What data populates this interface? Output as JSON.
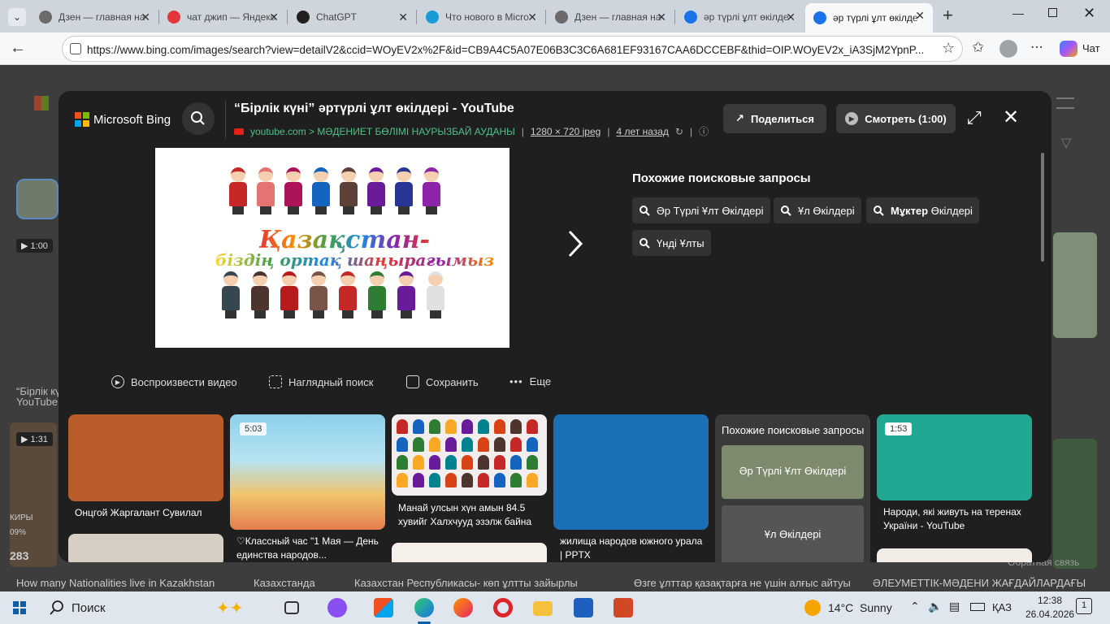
{
  "browser": {
    "tabs": [
      {
        "title": "Дзен — главная на",
        "fav_color": "#6b6b6b"
      },
      {
        "title": "чат джип — Яндекс",
        "fav_color": "#e2383c"
      },
      {
        "title": "ChatGPT",
        "fav_color": "#202020"
      },
      {
        "title": "Что нового в Micro",
        "fav_color": "#1a9bd7"
      },
      {
        "title": "Дзен — главная на",
        "fav_color": "#6b6b6b"
      },
      {
        "title": "әр түрлі ұлт өкілде",
        "fav_color": "#1a73e8"
      },
      {
        "title": "әр түрлі ұлт өкілде",
        "fav_color": "#1a73e8"
      }
    ],
    "url": "https://www.bing.com/images/search?view=detailV2&ccid=WOyEV2x%2F&id=CB9A4C5A07E06B3C3C6A681EF93167CAA6DCCEBF&thid=OIP.WOyEV2x_iA3SjM2YpnP...",
    "copilot_label": "Чат"
  },
  "modal": {
    "brand": "Microsoft Bing",
    "title": "“Бірлік күні” әртүрлі ұлт өкілдері - YouTube",
    "source": "youtube.com > МӘДЕНИЕТ БӨЛІМІ НАУРЫЗБАЙ АУДАНЫ",
    "dimensions": "1280 × 720 jpeg",
    "age": "4 лет назад",
    "share_label": "Поделиться",
    "watch_label": "Смотреть (1:00)",
    "image_text_line1": "Қазақстан-",
    "image_text_line2": "біздің ортақ шаңырағымыз",
    "related_heading": "Похожие поисковые запросы",
    "related_chips": [
      {
        "prefix": "",
        "text": "Әр Түрлі Ұлт Өкілдері"
      },
      {
        "prefix": "",
        "text": "Ұл Өкілдері"
      },
      {
        "prefix": "Мұктер",
        "text": " Өкілдері"
      },
      {
        "prefix": "",
        "text": "Үнді Ұлты"
      }
    ],
    "actions": [
      "Воспроизвести видео",
      "Наглядный поиск",
      "Сохранить",
      "Еще"
    ],
    "cards": [
      {
        "caption": "Онцгой Жаргалант Сувилал",
        "duration": "",
        "color": "#b85c2a"
      },
      {
        "caption": "♡Классный час \"1 Мая — День единства народов...",
        "duration": "5:03",
        "color": "#7bbfd8"
      },
      {
        "caption": "Манай улсын хүн амын 84.5 хувийг Халхчууд эзэлж байна",
        "duration": "",
        "color": "#e8e4e4"
      },
      {
        "caption": "жилища народов южного урала | PPTX",
        "duration": "",
        "color": "#1b6fb4"
      },
      {
        "caption": "Народи, які живуть на теренах України - YouTube",
        "duration": "1:53",
        "color": "#22a892"
      }
    ],
    "related_card": {
      "heading": "Похожие поисковые запросы",
      "items": [
        "Әр Түрлі Ұлт Өкілдері",
        "Ұл Өкілдері"
      ]
    }
  },
  "background": {
    "video_badge_1": "1:00",
    "video_badge_2": "1:31",
    "partial_text": "“Бірлік кү",
    "partial_text2": "YouTube",
    "captions": [
      "How many Nationalities live in Kazakhstan",
      "Казахстанда",
      "Казахстан Республикасы- көп ұлтты зайырлы",
      "Өзге ұлттар қазақтарға не үшін алғыс айтуы",
      "ӘЛЕУМЕТТІК-МӘДЕНИ ЖАҒДАЙЛАРДАҒЫ"
    ],
    "side_texts": [
      "КИРЫ",
      "09%",
      "283"
    ],
    "feedback": "Обратная связь"
  },
  "taskbar": {
    "search_label": "Поиск",
    "temperature": "14°C",
    "weather": "Sunny",
    "language": "ҚАЗ",
    "time": "12:38",
    "date": "26.04.2026",
    "notifications": "1"
  }
}
